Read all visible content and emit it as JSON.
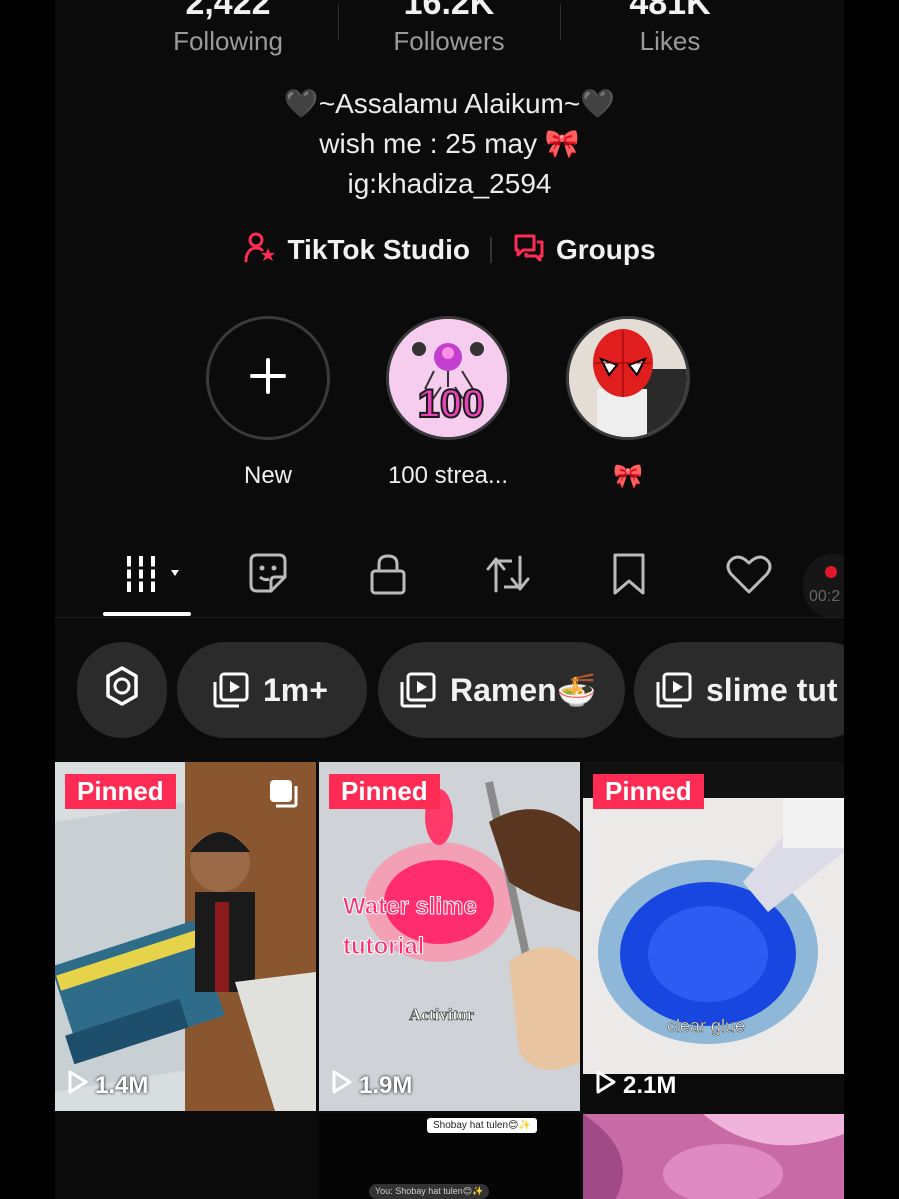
{
  "stats": [
    {
      "value": "2,422",
      "label": "Following"
    },
    {
      "value": "16.2K",
      "label": "Followers"
    },
    {
      "value": "481K",
      "label": "Likes"
    }
  ],
  "bio": [
    "🖤~Assalamu Alaikum~🖤",
    "wish me : 25 may 🎀",
    "ig:khadiza_2594"
  ],
  "links": {
    "studio": "TikTok Studio",
    "groups": "Groups"
  },
  "highlights": [
    {
      "label": "New"
    },
    {
      "label": "100 strea...",
      "badge": "100"
    },
    {
      "label": "🎀"
    }
  ],
  "tabs": [
    "videos-tab",
    "sticker-tab",
    "private-tab",
    "repost-tab",
    "saved-tab",
    "liked-tab"
  ],
  "live_timer": "00:2",
  "playlists": [
    {
      "label": "1m+"
    },
    {
      "label": "Ramen🍜"
    },
    {
      "label": "slime tut"
    }
  ],
  "videos": [
    {
      "pinned": "Pinned",
      "views": "1.4M"
    },
    {
      "pinned": "Pinned",
      "views": "1.9M",
      "overlay_title": "Water slime tutorial",
      "overlay_sub": "Activitor"
    },
    {
      "pinned": "Pinned",
      "views": "2.1M",
      "overlay_sub": "clear glue"
    }
  ],
  "bottom_row": {
    "caption": "Shobay hat tulen😊✨",
    "sub": "You: Shobay hat tulen😊✨"
  },
  "colors": {
    "accent": "#fe2c55",
    "background": "#0b0b0b",
    "chip": "#2b2b2b"
  }
}
